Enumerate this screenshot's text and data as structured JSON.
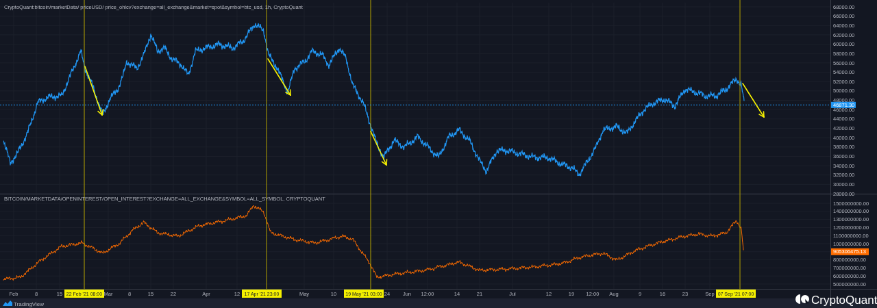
{
  "top_pane": {
    "title": "CryptoQuant:bitcoin/marketData/ priceUSD/ price_ohlcv?exchange=all_exchange&market=spot&symbol=btc_usd, 1h, CryptoQuant",
    "axis_labels": [
      "68000.00",
      "66000.00",
      "64000.00",
      "62000.00",
      "60000.00",
      "58000.00",
      "56000.00",
      "54000.00",
      "52000.00",
      "50000.00",
      "48000.00",
      "46000.00",
      "44000.00",
      "42000.00",
      "40000.00",
      "38000.00",
      "36000.00",
      "34000.00",
      "32000.00",
      "30000.00",
      "28000.00"
    ],
    "price_marker": "46871.30"
  },
  "bottom_pane": {
    "title": "BITCOIN/MARKETDATA/OPENINTEREST/OPEN_INTEREST?EXCHANGE=ALL_EXCHANGE&SYMBOL=ALL_SYMBOL, CRYPTOQUANT",
    "axis_labels": [
      "1500000000.00",
      "1400000000.00",
      "1300000000.00",
      "1200000000.00",
      "1100000000.00",
      "1000000000.00",
      "800000000.00",
      "700000000.00",
      "600000000.00",
      "500000000.00"
    ],
    "value_marker": "905306475.13"
  },
  "time_axis": {
    "labels": [
      {
        "text": "Feb",
        "kind": "tick"
      },
      {
        "text": "8",
        "kind": "tick"
      },
      {
        "text": "15",
        "kind": "tick"
      },
      {
        "text": "22 Feb '21 08:00",
        "kind": "highlight"
      },
      {
        "text": "Mar",
        "kind": "tick"
      },
      {
        "text": "8",
        "kind": "tick"
      },
      {
        "text": "15",
        "kind": "tick"
      },
      {
        "text": "22",
        "kind": "tick"
      },
      {
        "text": "Apr",
        "kind": "tick"
      },
      {
        "text": "12",
        "kind": "tick"
      },
      {
        "text": "17 Apr '21 23:00",
        "kind": "highlight"
      },
      {
        "text": "May",
        "kind": "tick"
      },
      {
        "text": "10",
        "kind": "tick"
      },
      {
        "text": "19 May '21 03:00",
        "kind": "highlight"
      },
      {
        "text": "24",
        "kind": "tick"
      },
      {
        "text": "Jun",
        "kind": "tick"
      },
      {
        "text": "12:00",
        "kind": "tick"
      },
      {
        "text": "14",
        "kind": "tick"
      },
      {
        "text": "21",
        "kind": "tick"
      },
      {
        "text": "Jul",
        "kind": "tick"
      },
      {
        "text": "12",
        "kind": "tick"
      },
      {
        "text": "19",
        "kind": "tick"
      },
      {
        "text": "12:00",
        "kind": "tick"
      },
      {
        "text": "Aug",
        "kind": "tick"
      },
      {
        "text": "9",
        "kind": "tick"
      },
      {
        "text": "16",
        "kind": "tick"
      },
      {
        "text": "23",
        "kind": "tick"
      },
      {
        "text": "Sep",
        "kind": "tick"
      },
      {
        "text": "07 Sep '21 07:00",
        "kind": "highlight"
      }
    ]
  },
  "footer": {
    "tradingview": "TradingView",
    "cryptoquant": "CryptoQuant"
  }
}
